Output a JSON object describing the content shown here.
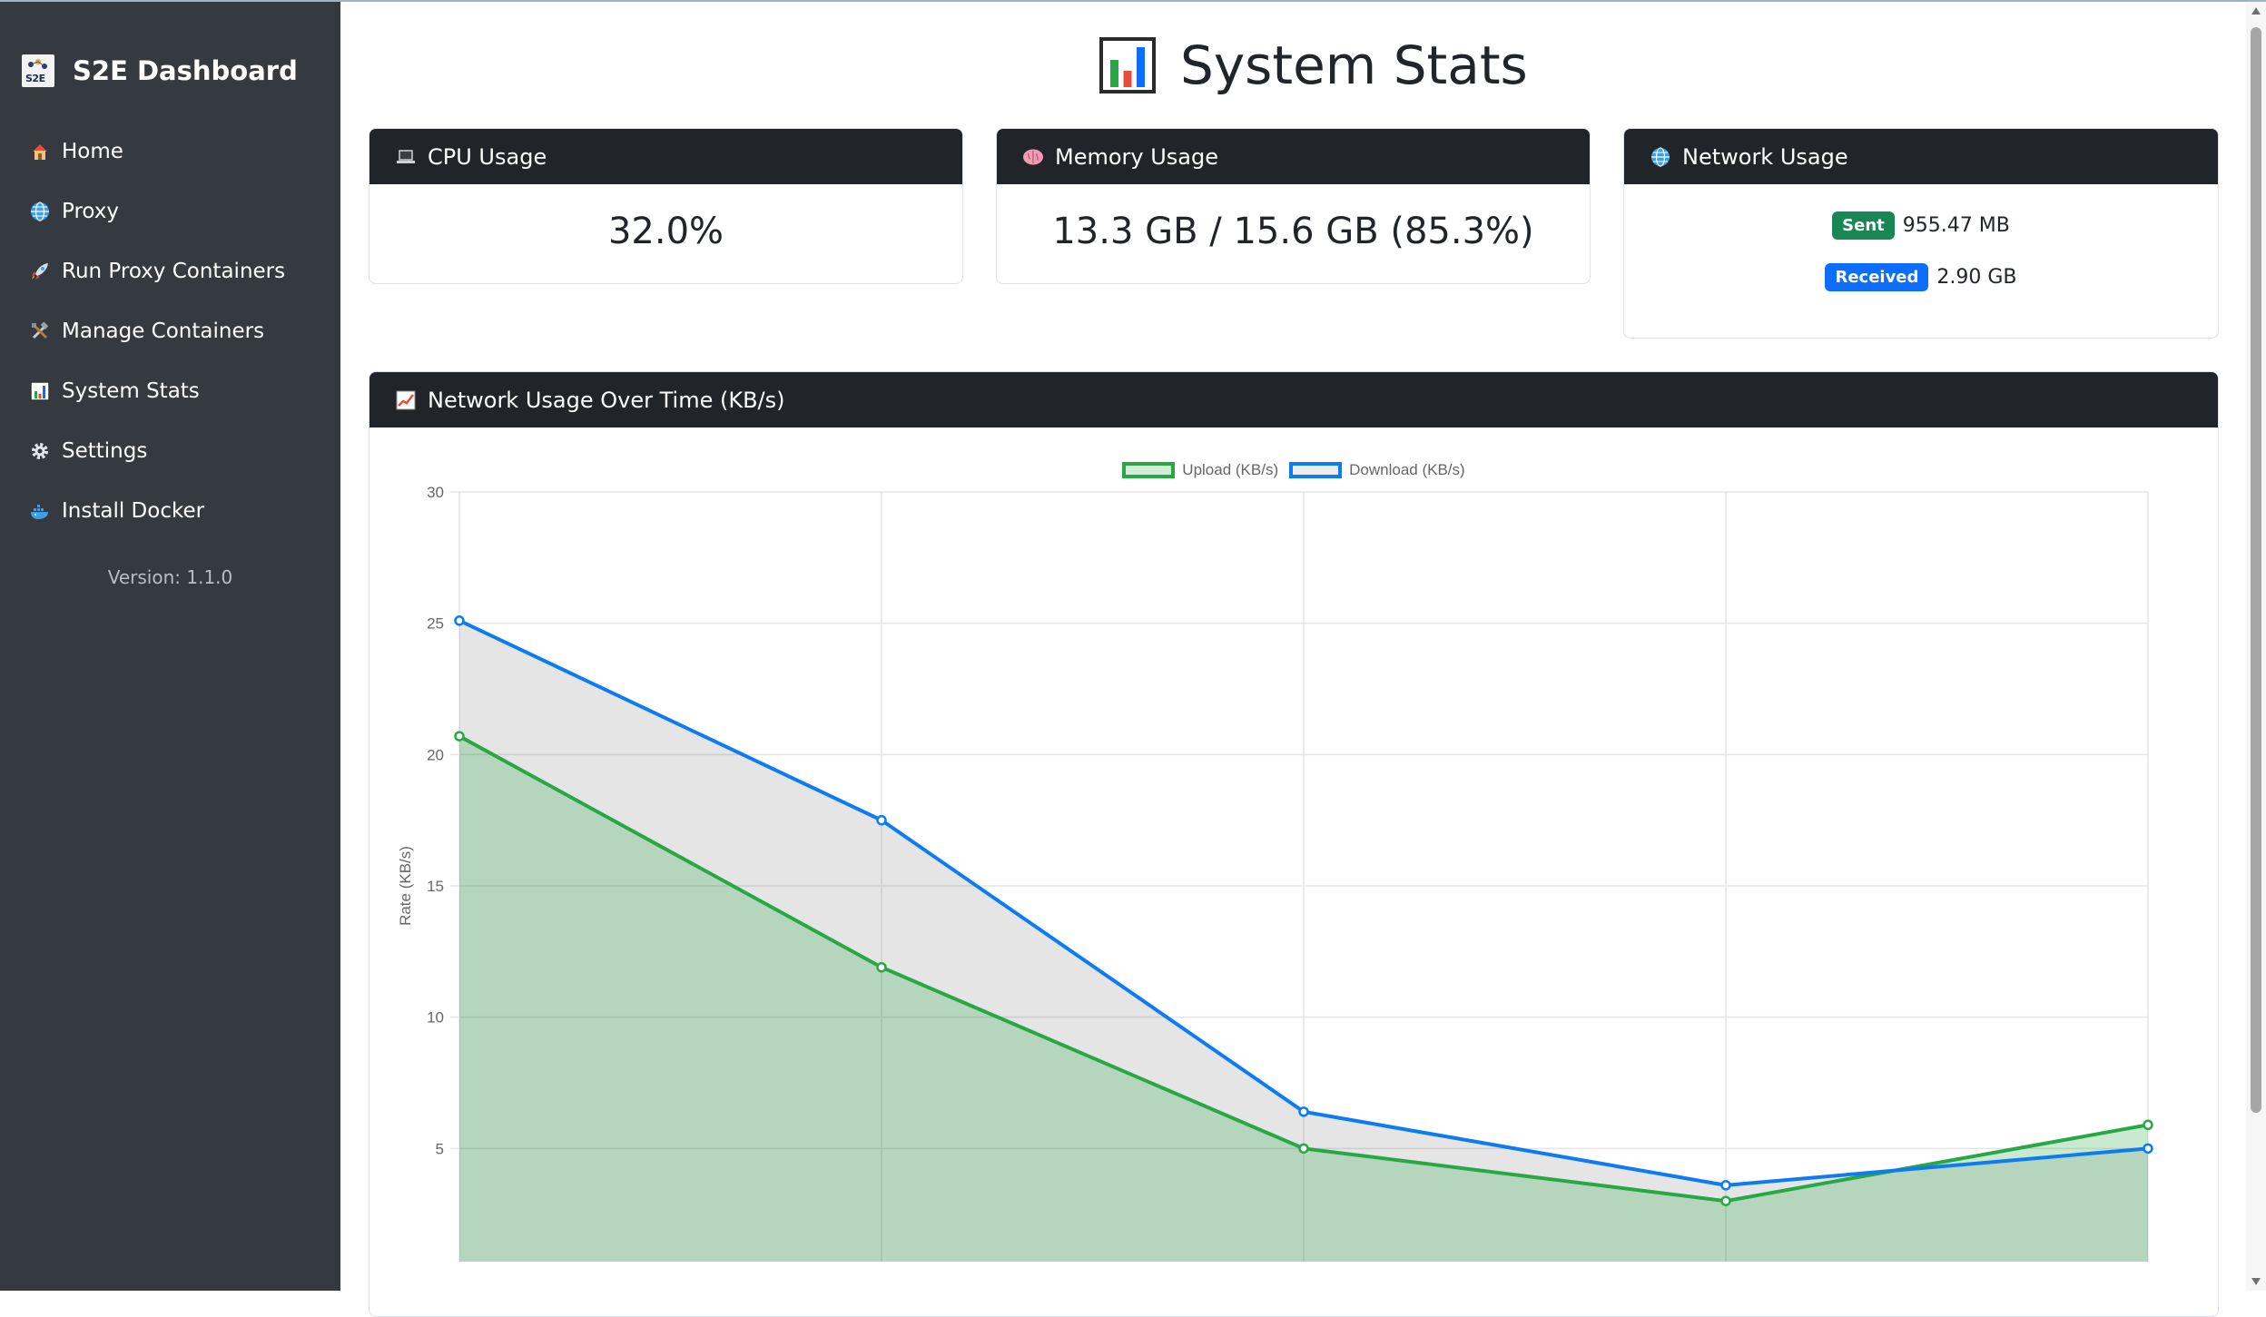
{
  "sidebar": {
    "brand": {
      "title": "S2E Dashboard",
      "logo_text": "S2E"
    },
    "items": [
      {
        "label": "Home",
        "icon": "house-icon"
      },
      {
        "label": "Proxy",
        "icon": "globe-icon"
      },
      {
        "label": "Run Proxy Containers",
        "icon": "rocket-icon"
      },
      {
        "label": "Manage Containers",
        "icon": "tools-icon"
      },
      {
        "label": "System Stats",
        "icon": "bar-chart-icon"
      },
      {
        "label": "Settings",
        "icon": "gear-icon"
      },
      {
        "label": "Install Docker",
        "icon": "docker-whale-icon"
      }
    ],
    "version": "Version: 1.1.0"
  },
  "main": {
    "title": "System Stats",
    "cards": {
      "cpu": {
        "header": "CPU Usage",
        "value": "32.0%"
      },
      "memory": {
        "header": "Memory Usage",
        "value": "13.3 GB / 15.6 GB (85.3%)"
      },
      "network": {
        "header": "Network Usage",
        "sent_label": "Sent",
        "sent_value": "955.47 MB",
        "received_label": "Received",
        "received_value": "2.90 GB"
      }
    },
    "chart_card": {
      "header": "Network Usage Over Time (KB/s)"
    }
  },
  "colors": {
    "sidebar_bg": "#343a40",
    "header_bg": "#212529",
    "upload": "#28a745",
    "download": "#0d7cf2",
    "sent_badge": "#198754",
    "received_badge": "#0d6efd"
  },
  "chart_data": {
    "type": "area",
    "title": "",
    "xlabel": "",
    "ylabel": "Rate (KB/s)",
    "ylim": [
      0,
      30
    ],
    "yticks": [
      0,
      5,
      10,
      15,
      20,
      25,
      30
    ],
    "grid": true,
    "legend": "top-center",
    "series": [
      {
        "name": "Upload (KB/s)",
        "color": "#28a745",
        "values": [
          20.7,
          11.9,
          5.0,
          3.0,
          5.9
        ]
      },
      {
        "name": "Download (KB/s)",
        "color": "#0d7cf2",
        "values": [
          25.1,
          17.5,
          6.4,
          3.6,
          5.0
        ]
      }
    ]
  }
}
